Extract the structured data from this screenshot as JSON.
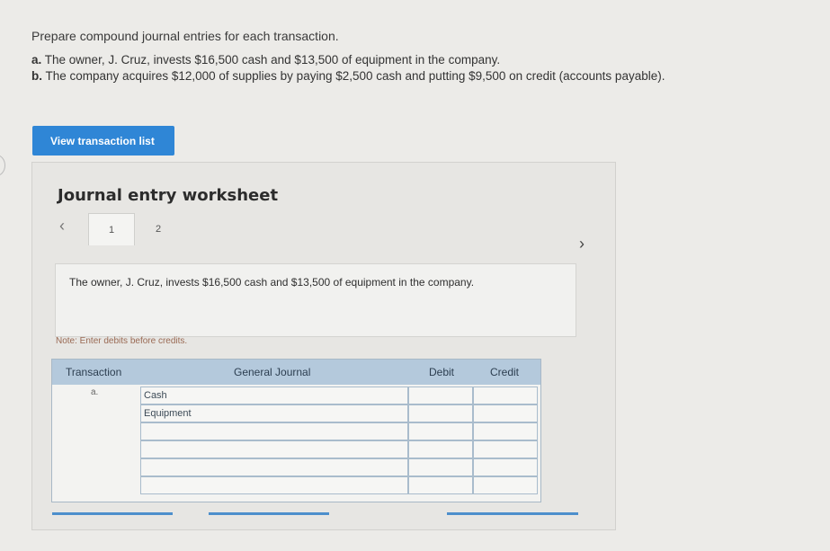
{
  "prompt": "Prepare compound journal entries for each transaction.",
  "transactions": [
    {
      "letter": "a.",
      "text": "The owner, J. Cruz, invests $16,500 cash and $13,500 of equipment in the company."
    },
    {
      "letter": "b.",
      "text": "The company acquires $12,000 of supplies by paying $2,500 cash and putting $9,500 on credit (accounts payable)."
    }
  ],
  "view_button": "View transaction list",
  "worksheet": {
    "title": "Journal entry worksheet",
    "prev_icon": "‹",
    "next_icon": "›",
    "tabs": [
      "1",
      "2"
    ],
    "description": "The owner, J. Cruz, invests $16,500 cash and $13,500 of equipment in the company.",
    "note": "Note: Enter debits before credits.",
    "table": {
      "headers": {
        "transaction": "Transaction",
        "journal": "General Journal",
        "debit": "Debit",
        "credit": "Credit"
      },
      "rows": [
        {
          "transaction": "a.",
          "account": "Cash",
          "debit": "",
          "credit": ""
        },
        {
          "transaction": "",
          "account": "Equipment",
          "debit": "",
          "credit": ""
        },
        {
          "transaction": "",
          "account": "",
          "debit": "",
          "credit": ""
        },
        {
          "transaction": "",
          "account": "",
          "debit": "",
          "credit": ""
        },
        {
          "transaction": "",
          "account": "",
          "debit": "",
          "credit": ""
        },
        {
          "transaction": "",
          "account": "",
          "debit": "",
          "credit": ""
        }
      ]
    }
  },
  "colors": {
    "accent": "#2f86d6",
    "table_header": "#b4c9dc"
  }
}
